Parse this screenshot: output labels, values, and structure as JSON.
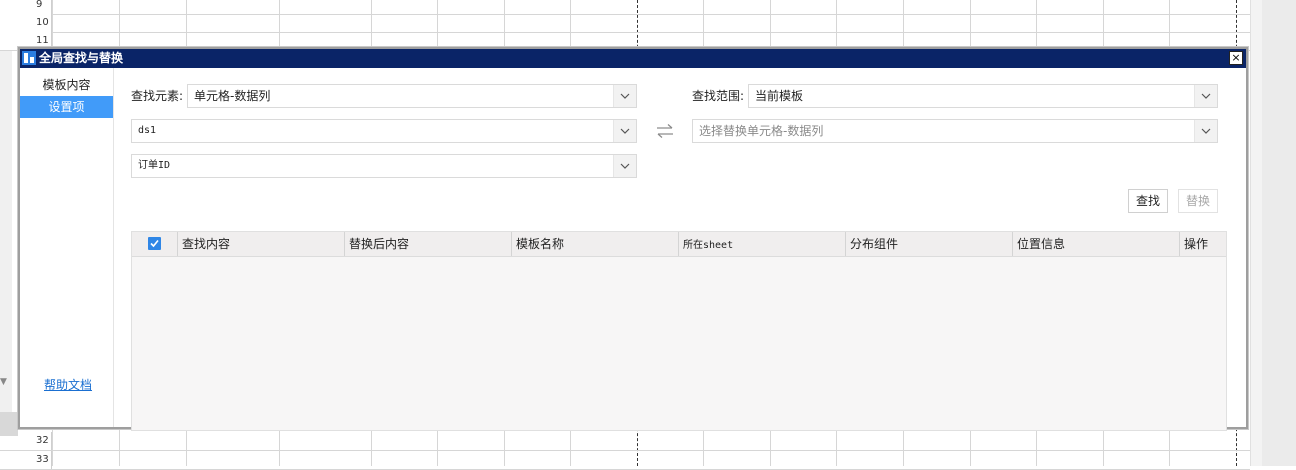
{
  "sheet": {
    "rows_top": [
      "9",
      "10",
      "11"
    ],
    "rows_bottom": [
      "32",
      "33"
    ]
  },
  "dialog": {
    "title": "全局查找与替换",
    "close_label": "×"
  },
  "sidebar": {
    "items": [
      {
        "label": "模板内容"
      },
      {
        "label": "设置项"
      }
    ],
    "help_link": "帮助文档"
  },
  "form": {
    "find_element_label": "查找元素:",
    "find_element_value": "单元格-数据列",
    "datasource_value": "ds1",
    "column_value": "订单ID",
    "scope_label": "查找范围:",
    "scope_value": "当前模板",
    "replace_placeholder": "选择替换单元格-数据列"
  },
  "buttons": {
    "find": "查找",
    "replace": "替换"
  },
  "table": {
    "columns": [
      "查找内容",
      "替换后内容",
      "模板名称",
      "所在sheet",
      "分布组件",
      "位置信息",
      "操作"
    ],
    "select_all_checked": true
  },
  "colors": {
    "titlebar": "#0a2467",
    "accent": "#419bf9",
    "link": "#1a6fd1"
  }
}
